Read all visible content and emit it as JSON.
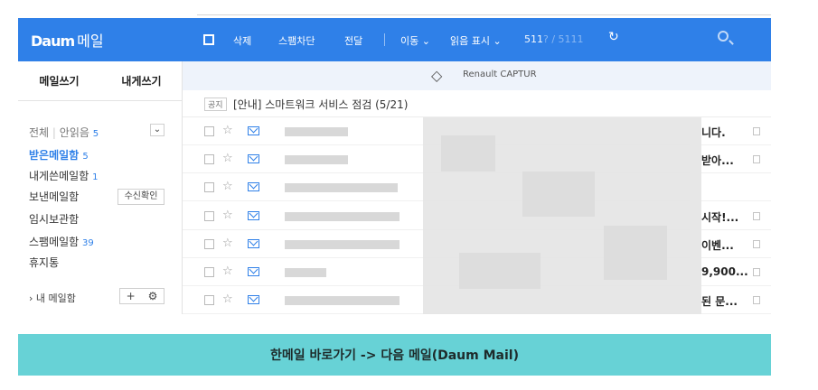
{
  "header": {
    "logo": "Daum",
    "logo_sub": "메일",
    "toolbar": {
      "delete": "삭제",
      "spam_block": "스팸차단",
      "forward": "전달",
      "move": "이동",
      "read_mark": "읽음 표시",
      "count_main": "511",
      "count_rest": "? / 5111"
    }
  },
  "sidebar": {
    "write": "메일쓰기",
    "write_me": "내게쓰기",
    "all": "전체",
    "unread": "안읽음",
    "unread_count": "5",
    "folders": [
      {
        "label": "받은메일함",
        "count": "5"
      },
      {
        "label": "내게쓴메일함",
        "count": "1"
      },
      {
        "label": "보낸메일함",
        "count": ""
      },
      {
        "label": "임시보관함",
        "count": ""
      },
      {
        "label": "스팸메일함",
        "count": "39"
      },
      {
        "label": "휴지통",
        "count": ""
      }
    ],
    "receipt_button": "수신확인",
    "my_folders": "내 메일함",
    "add_icon": "+",
    "gear_icon": "gear-icon"
  },
  "ad": {
    "text": "Renault CAPTUR"
  },
  "notice": {
    "tag": "공지",
    "text": "[안내] 스마트워크 서비스 점검 (5/21)"
  },
  "mail_rows": [
    {
      "tail": "니다."
    },
    {
      "tail": "받아..."
    },
    {
      "tail": ""
    },
    {
      "tail": "시작!..."
    },
    {
      "tail": "이벤..."
    },
    {
      "tail": "9,900..."
    },
    {
      "tail": "된 문..."
    }
  ],
  "banner": {
    "text": "한메일 바로가기 -> 다음 메일(Daum Mail)"
  }
}
